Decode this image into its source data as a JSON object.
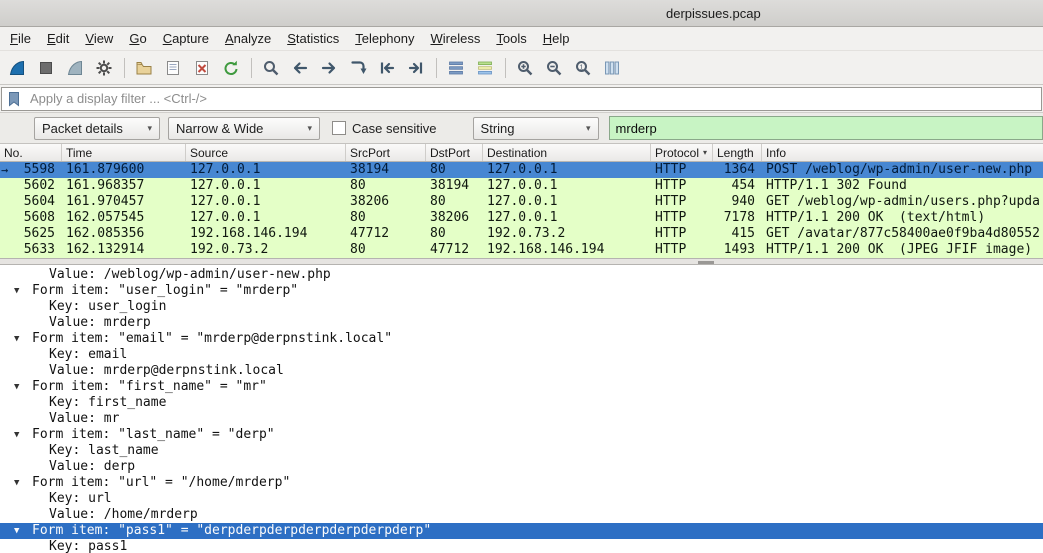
{
  "window": {
    "title": "derpissues.pcap"
  },
  "menu": {
    "items": [
      "File",
      "Edit",
      "View",
      "Go",
      "Capture",
      "Analyze",
      "Statistics",
      "Telephony",
      "Wireless",
      "Tools",
      "Help"
    ]
  },
  "toolbar": {
    "groups": [
      [
        "start-capture-icon",
        "stop-capture-icon",
        "restart-capture-icon",
        "capture-options-icon"
      ],
      [
        "open-file-icon",
        "save-file-icon",
        "close-file-icon",
        "reload-file-icon"
      ],
      [
        "find-packet-icon",
        "go-back-icon",
        "go-forward-icon",
        "go-to-packet-icon",
        "go-first-icon",
        "go-last-icon"
      ],
      [
        "auto-scroll-icon",
        "colorize-icon"
      ],
      [
        "zoom-in-icon",
        "zoom-out-icon",
        "zoom-original-icon",
        "resize-columns-icon"
      ]
    ]
  },
  "filter_bar": {
    "placeholder": "Apply a display filter ... <Ctrl-/>"
  },
  "find_bar": {
    "scope": "Packet details",
    "mode": "Narrow & Wide",
    "case_label": "Case sensitive",
    "type": "String",
    "query": "mrderp"
  },
  "packet_list": {
    "columns": [
      "No.",
      "Time",
      "Source",
      "SrcPort",
      "DstPort",
      "Destination",
      "Protocol",
      "Length",
      "Info"
    ],
    "rows": [
      {
        "no": "5598",
        "time": "161.879600",
        "source": "127.0.0.1",
        "srcport": "38194",
        "dstport": "80",
        "destination": "127.0.0.1",
        "protocol": "HTTP",
        "length": "1364",
        "info": "POST /weblog/wp-admin/user-new.php",
        "selected": true
      },
      {
        "no": "5602",
        "time": "161.968357",
        "source": "127.0.0.1",
        "srcport": "80",
        "dstport": "38194",
        "destination": "127.0.0.1",
        "protocol": "HTTP",
        "length": "454",
        "info": "HTTP/1.1 302 Found"
      },
      {
        "no": "5604",
        "time": "161.970457",
        "source": "127.0.0.1",
        "srcport": "38206",
        "dstport": "80",
        "destination": "127.0.0.1",
        "protocol": "HTTP",
        "length": "940",
        "info": "GET /weblog/wp-admin/users.php?upda"
      },
      {
        "no": "5608",
        "time": "162.057545",
        "source": "127.0.0.1",
        "srcport": "80",
        "dstport": "38206",
        "destination": "127.0.0.1",
        "protocol": "HTTP",
        "length": "7178",
        "info": "HTTP/1.1 200 OK  (text/html)"
      },
      {
        "no": "5625",
        "time": "162.085356",
        "source": "192.168.146.194",
        "srcport": "47712",
        "dstport": "80",
        "destination": "192.0.73.2",
        "protocol": "HTTP",
        "length": "415",
        "info": "GET /avatar/877c58400ae0f9ba4d80552"
      },
      {
        "no": "5633",
        "time": "162.132914",
        "source": "192.0.73.2",
        "srcport": "80",
        "dstport": "47712",
        "destination": "192.168.146.194",
        "protocol": "HTTP",
        "length": "1493",
        "info": "HTTP/1.1 200 OK  (JPEG JFIF image)"
      }
    ]
  },
  "details": {
    "lines": [
      {
        "indent": 2,
        "arrow": false,
        "text": "Value: /weblog/wp-admin/user-new.php"
      },
      {
        "indent": 1,
        "arrow": true,
        "text": "Form item: \"user_login\" = \"mrderp\""
      },
      {
        "indent": 2,
        "arrow": false,
        "text": "Key: user_login"
      },
      {
        "indent": 2,
        "arrow": false,
        "text": "Value: mrderp"
      },
      {
        "indent": 1,
        "arrow": true,
        "text": "Form item: \"email\" = \"mrderp@derpnstink.local\""
      },
      {
        "indent": 2,
        "arrow": false,
        "text": "Key: email"
      },
      {
        "indent": 2,
        "arrow": false,
        "text": "Value: mrderp@derpnstink.local"
      },
      {
        "indent": 1,
        "arrow": true,
        "text": "Form item: \"first_name\" = \"mr\""
      },
      {
        "indent": 2,
        "arrow": false,
        "text": "Key: first_name"
      },
      {
        "indent": 2,
        "arrow": false,
        "text": "Value: mr"
      },
      {
        "indent": 1,
        "arrow": true,
        "text": "Form item: \"last_name\" = \"derp\""
      },
      {
        "indent": 2,
        "arrow": false,
        "text": "Key: last_name"
      },
      {
        "indent": 2,
        "arrow": false,
        "text": "Value: derp"
      },
      {
        "indent": 1,
        "arrow": true,
        "text": "Form item: \"url\" = \"/home/mrderp\""
      },
      {
        "indent": 2,
        "arrow": false,
        "text": "Key: url"
      },
      {
        "indent": 2,
        "arrow": false,
        "text": "Value: /home/mrderp"
      },
      {
        "indent": 1,
        "arrow": true,
        "selected": true,
        "text": "Form item: \"pass1\" = \"derpderpderpderpderpderpderp\""
      },
      {
        "indent": 2,
        "arrow": false,
        "text": "Key: pass1"
      }
    ]
  }
}
